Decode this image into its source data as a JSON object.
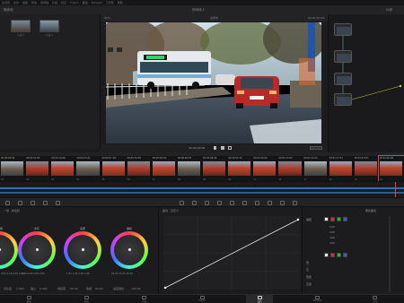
{
  "menubar": {
    "items": [
      "达芬奇",
      "文件",
      "编辑",
      "修剪",
      "时间线",
      "片段",
      "标记",
      "Fusion",
      "颜色",
      "Fairlight",
      "工作区",
      "帮助"
    ]
  },
  "toolbar": {
    "left_label": "媒体池",
    "center_title": "时间线 1",
    "right_label": "片段"
  },
  "viewer": {
    "title": "北京中",
    "timecode_left": "37%",
    "timecode_right": "00:00:00:00",
    "nav_timecode": "00:00:09:06"
  },
  "media_pool": {
    "thumbs": [
      {
        "label": "片段 1"
      },
      {
        "label": "片段 2"
      }
    ]
  },
  "timeline_clips": [
    {
      "tc": "00:00:05:06",
      "num": "01",
      "scene": "city"
    },
    {
      "tc": "00:00:12:00",
      "num": "02",
      "scene": "gate"
    },
    {
      "tc": "00:00:19:06",
      "num": "03",
      "scene": "temple"
    },
    {
      "tc": "00:00:23:21",
      "num": "04",
      "scene": "city"
    },
    {
      "tc": "00:00:27:18",
      "num": "05",
      "scene": "temple"
    },
    {
      "tc": "00:00:34:09",
      "num": "06",
      "scene": "gate"
    },
    {
      "tc": "00:00:38:03",
      "num": "07",
      "scene": "temple"
    },
    {
      "tc": "00:00:40:03",
      "num": "08",
      "scene": "city"
    },
    {
      "tc": "00:00:46:04",
      "num": "09",
      "scene": "gate"
    },
    {
      "tc": "00:00:51:10",
      "num": "10",
      "scene": "temple"
    },
    {
      "tc": "00:01:00:09",
      "num": "11",
      "scene": "temple"
    },
    {
      "tc": "00:01:03:02",
      "num": "12",
      "scene": "gate"
    },
    {
      "tc": "00:01:14:14",
      "num": "13",
      "scene": "city"
    },
    {
      "tc": "00:01:17:11",
      "num": "14",
      "scene": "temple"
    },
    {
      "tc": "00:01:23:19",
      "num": "15",
      "scene": "gate"
    },
    {
      "tc": "00:01:40:06",
      "num": "16",
      "scene": "temple"
    }
  ],
  "wheels": {
    "header_left": "一级 - 校色轮",
    "items": [
      {
        "name": "暗部",
        "values": "0.00  0.00  0.00  0.00"
      },
      {
        "name": "中灰",
        "values": "0.00  0.00  0.00  0.00"
      },
      {
        "name": "亮部",
        "values": "1.00  1.00  1.00  1.00"
      },
      {
        "name": "偏移",
        "values": "25.00  25.00  25.00"
      }
    ],
    "footer": [
      "对比度",
      "1.000",
      "轴心",
      "0.435",
      "饱和度",
      "50.00",
      "色相",
      "50.00",
      "亮度混合",
      "100.00"
    ]
  },
  "curves": {
    "title": "曲线 - 自定义"
  },
  "curve_controls": {
    "edit_label": "编辑",
    "soft_clip": "柔化裁切",
    "rows": [
      "低",
      "高",
      "低柔",
      "高柔"
    ],
    "channel_values": [
      "100",
      "100",
      "100",
      "100"
    ]
  },
  "page_nav": {
    "items": [
      "媒体",
      "快编",
      "剪辑",
      "Fusion",
      "调色",
      "Fairlight",
      "交付"
    ],
    "active_index": 4
  },
  "colors": {
    "accent": "#e0483a",
    "timeline_blue": "#2f6fb3"
  }
}
